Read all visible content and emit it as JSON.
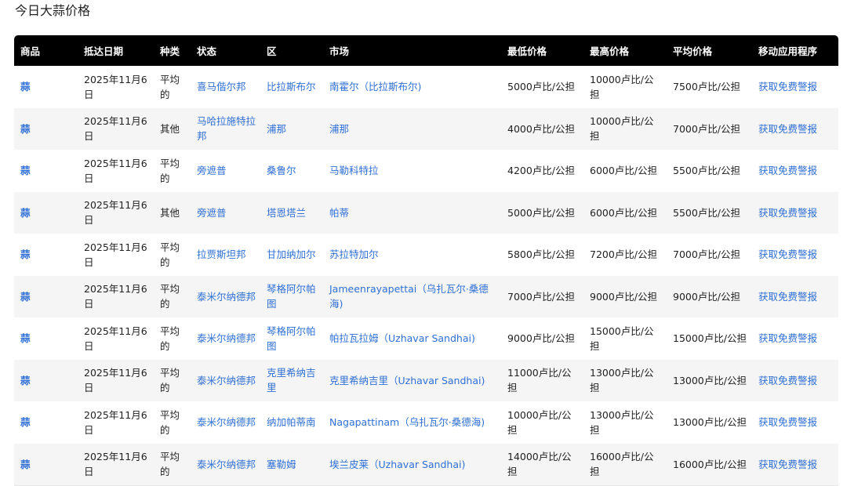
{
  "page": {
    "title": "今日大蒜价格"
  },
  "table": {
    "headers": [
      "商品",
      "抵达日期",
      "种类",
      "状态",
      "区",
      "市场",
      "最低价格",
      "最高价格",
      "平均价格",
      "移动应用程序"
    ],
    "rows": [
      [
        "蒜",
        "2025年11月6日",
        "平均的",
        "喜马偕尔邦",
        "比拉斯布尔",
        "南霍尔（比拉斯布尔)",
        "5000卢比/公担",
        "10000卢比/公担",
        "7500卢比/公担",
        "获取免费警报"
      ],
      [
        "蒜",
        "2025年11月6日",
        "其他",
        "马哈拉施特拉邦",
        "浦那",
        "浦那",
        "4000卢比/公担",
        "10000卢比/公担",
        "7000卢比/公担",
        "获取免费警报"
      ],
      [
        "蒜",
        "2025年11月6日",
        "平均的",
        "旁遮普",
        "桑鲁尔",
        "马勒科特拉",
        "4200卢比/公担",
        "6000卢比/公担",
        "5500卢比/公担",
        "获取免费警报"
      ],
      [
        "蒜",
        "2025年11月6日",
        "其他",
        "旁遮普",
        "塔恩塔兰",
        "帕蒂",
        "5000卢比/公担",
        "6000卢比/公担",
        "5500卢比/公担",
        "获取免费警报"
      ],
      [
        "蒜",
        "2025年11月6日",
        "平均的",
        "拉贾斯坦邦",
        "甘加纳加尔",
        "苏拉特加尔",
        "5800卢比/公担",
        "7200卢比/公担",
        "7000卢比/公担",
        "获取免费警报"
      ],
      [
        "蒜",
        "2025年11月6日",
        "平均的",
        "泰米尔纳德邦",
        "琴格阿尔帕图",
        "Jameenrayapettai（乌扎瓦尔·桑德海)",
        "7000卢比/公担",
        "9000卢比/公担",
        "9000卢比/公担",
        "获取免费警报"
      ],
      [
        "蒜",
        "2025年11月6日",
        "平均的",
        "泰米尔纳德邦",
        "琴格阿尔帕图",
        "帕拉瓦拉姆（Uzhavar Sandhai)",
        "9000卢比/公担",
        "15000卢比/公担",
        "15000卢比/公担",
        "获取免费警报"
      ],
      [
        "蒜",
        "2025年11月6日",
        "平均的",
        "泰米尔纳德邦",
        "克里希纳吉里",
        "克里希纳吉里（Uzhavar Sandhai)",
        "11000卢比/公担",
        "13000卢比/公担",
        "13000卢比/公担",
        "获取免费警报"
      ],
      [
        "蒜",
        "2025年11月6日",
        "平均的",
        "泰米尔纳德邦",
        "纳加帕蒂南",
        "Nagapattinam（乌扎瓦尔·桑德海)",
        "10000卢比/公担",
        "13000卢比/公担",
        "13000卢比/公担",
        "获取免费警报"
      ],
      [
        "蒜",
        "2025年11月6日",
        "平均的",
        "泰米尔纳德邦",
        "塞勒姆",
        "埃兰皮莱（Uzhavar Sandhai)",
        "14000卢比/公担",
        "16000卢比/公担",
        "16000卢比/公担",
        "获取免费警报"
      ]
    ]
  },
  "colors": {
    "link": "#2f6fd6",
    "header_bg": "#000000",
    "stripe": "#f5f5f5"
  }
}
